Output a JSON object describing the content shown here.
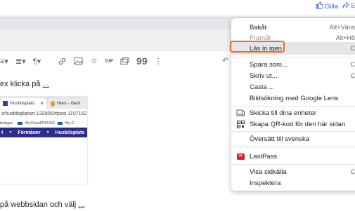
{
  "header": {
    "like_label": "Gilla",
    "share_label": "S"
  },
  "editor": {
    "line1": "ex klicka på",
    "line1_dots": "...",
    "line2": "på webbsidan och välj",
    "line2_dots": "..."
  },
  "toolbar": {
    "icons": [
      "list-icon",
      "align-icon",
      "paragraph-icon",
      "link-icon",
      "image-icon",
      "emoji-icon",
      "gif-icon",
      "media-icon",
      "quote-icon",
      "undo-icon"
    ]
  },
  "screenshot": {
    "tab1": "Husbilsplats",
    "tab1_close": "×",
    "tab2": "Hem - Genl",
    "url": "s/husbilsplatser.132905/#post-1197152",
    "bookmarks": [
      "ikringar",
      "MyCloudPR2100",
      "My C"
    ],
    "nav": [
      "t",
      "Förmåner",
      "Husbilsplats"
    ]
  },
  "context_menu": {
    "items": [
      {
        "label": "Bakåt",
        "shortcut": "Alt+Väns",
        "disabled": false
      },
      {
        "label": "Framåt",
        "shortcut": "Alt+Hö",
        "disabled": true
      },
      {
        "label": "Läs in igen",
        "shortcut": "C",
        "highlighted": true
      },
      {
        "label": "Spara som...",
        "shortcut": "C"
      },
      {
        "label": "Skriv ut...",
        "shortcut": "C"
      },
      {
        "label": "Casta ..."
      },
      {
        "label": "Bildsökning med Google Lens"
      },
      {
        "label": "Skicka till dina enheter",
        "icon": "devices-icon"
      },
      {
        "label": "Skapa QR-kod för den här sidan",
        "icon": "qr-code-icon"
      },
      {
        "label": "Översätt till svenska"
      },
      {
        "label": "LastPass",
        "icon": "lastpass-icon"
      },
      {
        "label": "Visa sidkälla",
        "shortcut": "C"
      },
      {
        "label": "Inspektera"
      }
    ]
  },
  "colors": {
    "accent_link": "#3b5bdb",
    "highlight_outline": "#f26a1f",
    "forum_nav": "#2e2c8a",
    "lastpass_red": "#d32d27"
  }
}
